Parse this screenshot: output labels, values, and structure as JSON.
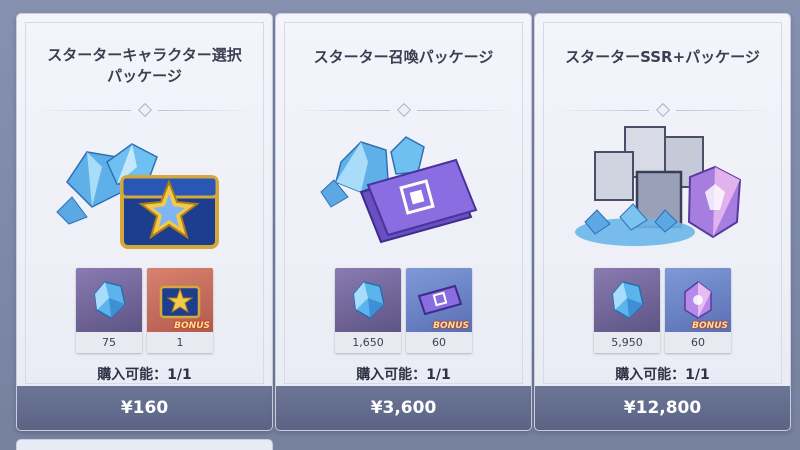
{
  "packages": [
    {
      "title": "スターターキャラクター選択\nパッケージ",
      "items": [
        {
          "icon": "crystal-icon",
          "count": "75",
          "bg": "purple"
        },
        {
          "icon": "chest-icon",
          "count": "1",
          "bg": "orange",
          "bonus": "BONUS"
        }
      ],
      "limit": "購入可能：1/1",
      "price": "¥160"
    },
    {
      "title": "スターター召喚パッケージ",
      "items": [
        {
          "icon": "crystal-icon",
          "count": "1,650",
          "bg": "purple"
        },
        {
          "icon": "ticket-icon",
          "count": "60",
          "bg": "blue",
          "bonus": "BONUS",
          "badge": "%"
        }
      ],
      "limit": "購入可能：1/1",
      "price": "¥3,600"
    },
    {
      "title": "スターターSSR+パッケージ",
      "items": [
        {
          "icon": "crystal-icon",
          "count": "5,950",
          "bg": "purple"
        },
        {
          "icon": "ssr-crystal-icon",
          "count": "60",
          "bg": "blue",
          "bonus": "BONUS",
          "badge": "%"
        }
      ],
      "limit": "購入可能：1/1",
      "price": "¥12,800"
    }
  ]
}
